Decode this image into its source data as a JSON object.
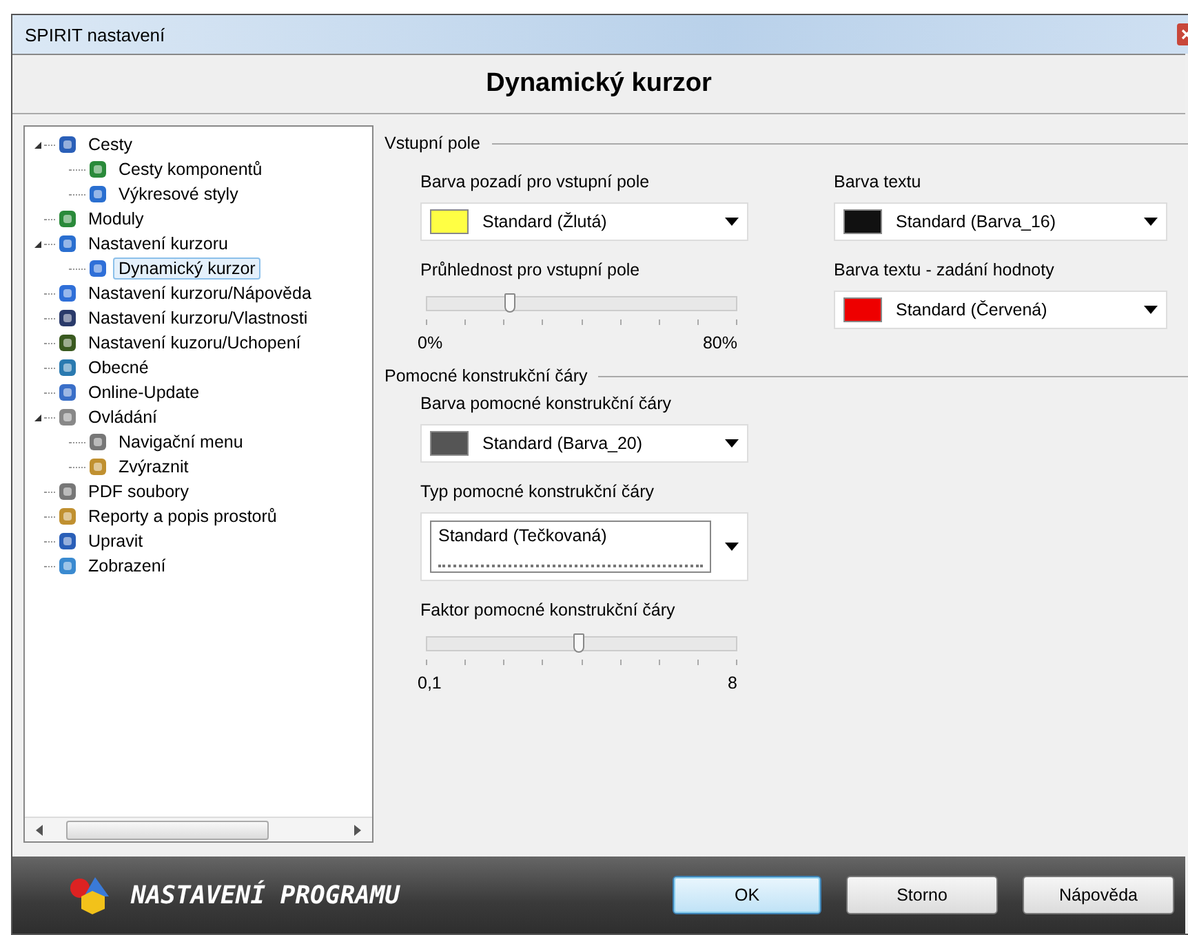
{
  "window": {
    "title": "SPIRIT nastavení"
  },
  "header": {
    "title": "Dynamický kurzor"
  },
  "tree": [
    {
      "label": "Cesty",
      "expanded": true,
      "selected": false,
      "children": [
        {
          "label": "Cesty komponentů",
          "selected": false
        },
        {
          "label": "Výkresové styly",
          "selected": false
        }
      ]
    },
    {
      "label": "Moduly",
      "selected": false
    },
    {
      "label": "Nastavení kurzoru",
      "expanded": true,
      "selected": false,
      "children": [
        {
          "label": "Dynamický kurzor",
          "selected": true
        }
      ]
    },
    {
      "label": "Nastavení kurzoru/Nápověda",
      "selected": false
    },
    {
      "label": "Nastavení kurzoru/Vlastnosti",
      "selected": false
    },
    {
      "label": "Nastavení kuzoru/Uchopení",
      "selected": false
    },
    {
      "label": "Obecné",
      "selected": false
    },
    {
      "label": "Online-Update",
      "selected": false
    },
    {
      "label": "Ovládání",
      "expanded": true,
      "selected": false,
      "children": [
        {
          "label": "Navigační menu",
          "selected": false
        },
        {
          "label": "Zvýraznit",
          "selected": false
        }
      ]
    },
    {
      "label": "PDF soubory",
      "selected": false
    },
    {
      "label": "Reporty a popis prostorů",
      "selected": false
    },
    {
      "label": "Upravit",
      "selected": false
    },
    {
      "label": "Zobrazení",
      "selected": false
    }
  ],
  "sections": [
    {
      "title": "Vstupní pole",
      "fields": [
        {
          "kind": "color",
          "label": "Barva pozadí pro vstupní pole",
          "value": "Standard (Žlutá)",
          "color": "#ffff44"
        },
        {
          "kind": "color",
          "label": "Barva textu",
          "value": "Standard (Barva_16)",
          "color": "#111111"
        },
        {
          "kind": "slider",
          "label": "Průhlednost pro vstupní pole",
          "level": 0.27,
          "min": "0%",
          "max": "80%"
        },
        {
          "kind": "color",
          "label": "Barva textu - zadání hodnoty",
          "value": "Standard (Červená)",
          "color": "#ee0000"
        }
      ]
    },
    {
      "title": "Pomocné konstrukční čáry",
      "fields": [
        {
          "kind": "color",
          "label": "Barva pomocné konstrukční čáry",
          "value": "Standard (Barva_20)",
          "color": "#555555"
        },
        {
          "kind": "linetype",
          "label": "Typ pomocné konstrukční čáry",
          "value": "Standard (Tečkovaná)"
        },
        {
          "kind": "slider",
          "label": "Faktor pomocné konstrukční čáry",
          "level": 0.49,
          "min": "0,1",
          "max": "8"
        }
      ]
    }
  ],
  "footer": {
    "banner": "NASTAVENÍ PROGRAMU",
    "buttons": [
      {
        "label": "OK",
        "default": true
      },
      {
        "label": "Storno",
        "default": false
      },
      {
        "label": "Nápověda",
        "default": false
      }
    ]
  }
}
